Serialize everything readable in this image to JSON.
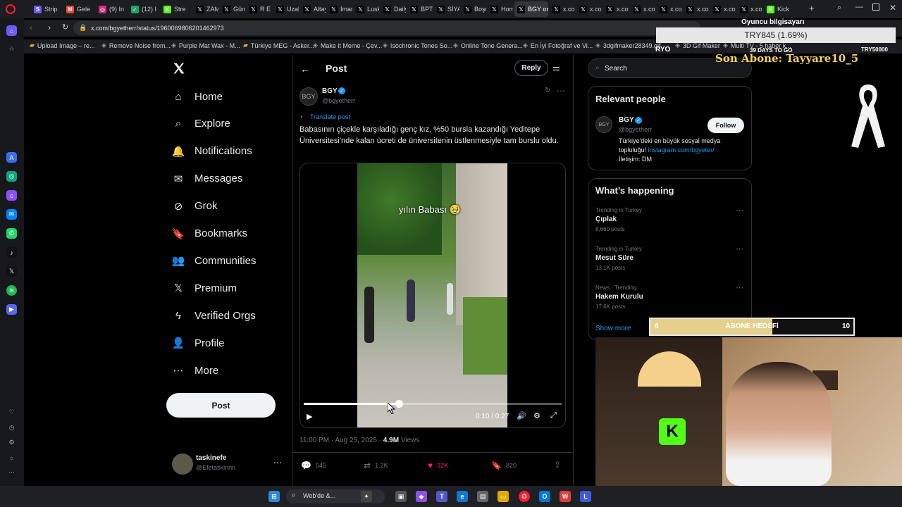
{
  "browser": {
    "tabs": [
      {
        "label": "Strip",
        "icon": "stripe-icon",
        "color": "#635bff",
        "glyph": "S"
      },
      {
        "label": "Gele",
        "icon": "gmail-icon",
        "color": "#ea4335",
        "glyph": "M"
      },
      {
        "label": "(9) In",
        "icon": "instagram-icon",
        "color": "#d62976",
        "glyph": "◎"
      },
      {
        "label": "(12) I",
        "icon": "app-icon",
        "color": "#1da462",
        "glyph": "✓"
      },
      {
        "label": "Stre",
        "icon": "kick-icon",
        "color": "#53fc18",
        "glyph": "K"
      },
      {
        "label": "ZAM",
        "icon": "x-icon",
        "color": "#000000",
        "glyph": "𝕏"
      },
      {
        "label": "Günc",
        "icon": "x-icon",
        "color": "#000000",
        "glyph": "𝕏"
      },
      {
        "label": "R E N",
        "icon": "x-icon",
        "color": "#000000",
        "glyph": "𝕏"
      },
      {
        "label": "Uzak",
        "icon": "x-icon",
        "color": "#000000",
        "glyph": "𝕏"
      },
      {
        "label": "Altay",
        "icon": "x-icon",
        "color": "#000000",
        "glyph": "𝕏"
      },
      {
        "label": "İman",
        "icon": "x-icon",
        "color": "#000000",
        "glyph": "𝕏"
      },
      {
        "label": "Lusk",
        "icon": "x-icon",
        "color": "#000000",
        "glyph": "𝕏"
      },
      {
        "label": "Daily",
        "icon": "x-icon",
        "color": "#000000",
        "glyph": "𝕏"
      },
      {
        "label": "BPT",
        "icon": "x-icon",
        "color": "#000000",
        "glyph": "𝕏"
      },
      {
        "label": "SİYA",
        "icon": "x-icon",
        "color": "#000000",
        "glyph": "𝕏"
      },
      {
        "label": "Boşu",
        "icon": "x-icon",
        "color": "#000000",
        "glyph": "𝕏"
      },
      {
        "label": "Hom",
        "icon": "x-icon",
        "color": "#000000",
        "glyph": "𝕏"
      },
      {
        "label": "BGY on X",
        "icon": "x-icon",
        "color": "#000000",
        "glyph": "𝕏",
        "active": true
      },
      {
        "label": "x.com",
        "icon": "x-icon",
        "color": "#000000",
        "glyph": "𝕏"
      },
      {
        "label": "x.com",
        "icon": "x-icon",
        "color": "#000000",
        "glyph": "𝕏"
      },
      {
        "label": "x.com",
        "icon": "x-icon",
        "color": "#000000",
        "glyph": "𝕏"
      },
      {
        "label": "x.com",
        "icon": "x-icon",
        "color": "#000000",
        "glyph": "𝕏"
      },
      {
        "label": "x.com",
        "icon": "x-icon",
        "color": "#000000",
        "glyph": "𝕏"
      },
      {
        "label": "x.com",
        "icon": "x-icon",
        "color": "#000000",
        "glyph": "𝕏"
      },
      {
        "label": "x.com",
        "icon": "x-icon",
        "color": "#000000",
        "glyph": "𝕏"
      },
      {
        "label": "x.com",
        "icon": "x-icon",
        "color": "#000000",
        "glyph": "𝕏"
      },
      {
        "label": "Kick",
        "icon": "kick-icon",
        "color": "#53fc18",
        "glyph": "K"
      }
    ],
    "url": "x.com/bgyetherr/status/1960069806201462973",
    "bookmarks": [
      {
        "label": "Upload Image – re...",
        "icon": "folder-icon"
      },
      {
        "label": "Remove Noise from...",
        "icon": "bookmark-icon"
      },
      {
        "label": "Purple Mat Wax - M...",
        "icon": "bookmark-icon"
      },
      {
        "label": "Türkiye MEG - Asker...",
        "icon": "folder-icon"
      },
      {
        "label": "Make it Meme - Çev...",
        "icon": "bookmark-icon"
      },
      {
        "label": "Isochronic Tones So...",
        "icon": "bookmark-icon"
      },
      {
        "label": "Online Tone Genera...",
        "icon": "bookmark-icon"
      },
      {
        "label": "En İyi Fotoğraf ve Vi...",
        "icon": "bookmark-icon"
      },
      {
        "label": "3dgifmaker28349.gif",
        "icon": "bookmark-icon"
      },
      {
        "label": "3D Gif Maker",
        "icon": "bookmark-icon"
      },
      {
        "label": "Multi TV - 5 haber k...",
        "icon": "bookmark-icon"
      }
    ]
  },
  "nav": {
    "items": [
      {
        "label": "Home",
        "icon": "home-icon"
      },
      {
        "label": "Explore",
        "icon": "search-icon"
      },
      {
        "label": "Notifications",
        "icon": "bell-icon"
      },
      {
        "label": "Messages",
        "icon": "envelope-icon"
      },
      {
        "label": "Grok",
        "icon": "grok-icon"
      },
      {
        "label": "Bookmarks",
        "icon": "bookmark-icon"
      },
      {
        "label": "Communities",
        "icon": "people-icon"
      },
      {
        "label": "Premium",
        "icon": "x-logo-icon"
      },
      {
        "label": "Verified Orgs",
        "icon": "lightning-icon"
      },
      {
        "label": "Profile",
        "icon": "person-icon"
      },
      {
        "label": "More",
        "icon": "more-circle-icon"
      }
    ],
    "post_button": "Post",
    "account": {
      "name": "taskinefe",
      "handle": "@Efetaskinnn"
    }
  },
  "post": {
    "header_title": "Post",
    "reply_button": "Reply",
    "author_name": "BGY",
    "author_handle": "@bgyetherr",
    "translate": "Translate post",
    "text": "Babasının çiçekle karşıladığı genç kız, %50 bursla kazandığı Yeditepe Üniversitesi'nde kalan ücreti de üniversitenin üstlenmesiyle tam burslu oldu.",
    "video_caption": "yılın Babası 🥹",
    "video_time": "0:10 / 0:27",
    "video_progress": 0.37,
    "timestamp": "11:00 PM · Aug 25, 2025",
    "views_count": "4.9M",
    "views_label": "Views",
    "replies": "545",
    "reposts": "1.2K",
    "likes": "32K",
    "bookmarks": "820"
  },
  "right": {
    "search_placeholder": "Search",
    "relevant_title": "Relevant people",
    "person": {
      "name": "BGY",
      "handle": "@bgyetherr",
      "follow": "Follow",
      "bio": "Türkiye'deki en büyük sosyal medya topluluğu!",
      "bio_link": "instagram.com/bgyeter/",
      "bio_contact": "İletişim: DM"
    },
    "happening_title": "What’s happening",
    "trends": [
      {
        "category": "Trending in Turkey",
        "name": "Çıplak",
        "count": "8,660 posts"
      },
      {
        "category": "Trending in Turkey",
        "name": "Mesut Süre",
        "count": "13.1K posts"
      },
      {
        "category": "News · Trending",
        "name": "Hakem Kurulu",
        "count": "17.6K posts"
      }
    ],
    "show_more": "Show more"
  },
  "overlay": {
    "top_label": "Oyuncu bilgisayarı",
    "target_value": "TRY845 (1.69%)",
    "left_code": "RYO",
    "days": "39 DAYS TO GO",
    "right_code": "TRY50000",
    "last_sub": "Son Abone: Tayyare10_5",
    "goal_left": "6",
    "goal_label": "ABONE HEDEFİ",
    "goal_right": "10",
    "goal_progress": 0.6
  },
  "taskbar": {
    "search": "Web'de &..."
  },
  "colors": {
    "accent": "#1d9bf0",
    "like": "#f91880",
    "kick": "#53fc18",
    "overlay_gold": "#f7d154"
  }
}
